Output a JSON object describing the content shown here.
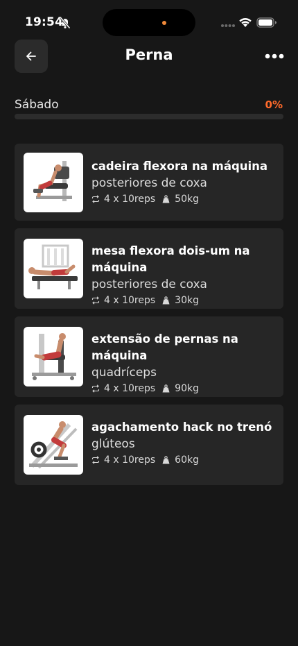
{
  "status": {
    "time": "19:54"
  },
  "header": {
    "title": "Perna"
  },
  "progress": {
    "day": "Sábado",
    "percent_label": "0%",
    "fraction": 0
  },
  "exercises": [
    {
      "name": "cadeira flexora na máquina",
      "muscle": "posteriores de coxa",
      "sets": "4 x 10reps",
      "weight": "50kg"
    },
    {
      "name": "mesa flexora dois-um na máquina",
      "muscle": "posteriores de coxa",
      "sets": "4 x 10reps",
      "weight": "30kg"
    },
    {
      "name": "extensão de pernas na máquina",
      "muscle": "quadríceps",
      "sets": "4 x 10reps",
      "weight": "90kg"
    },
    {
      "name": "agachamento hack no trenó",
      "muscle": "glúteos",
      "sets": "4 x 10reps",
      "weight": "60kg"
    }
  ],
  "icons": {
    "back": "arrow-left-icon",
    "more": "more-horizontal-icon",
    "repeat": "repeat-icon",
    "weight": "weight-icon",
    "silent": "bell-slash-icon"
  },
  "colors": {
    "accent": "#ff6a2b",
    "background": "#171717",
    "card": "#262626"
  }
}
